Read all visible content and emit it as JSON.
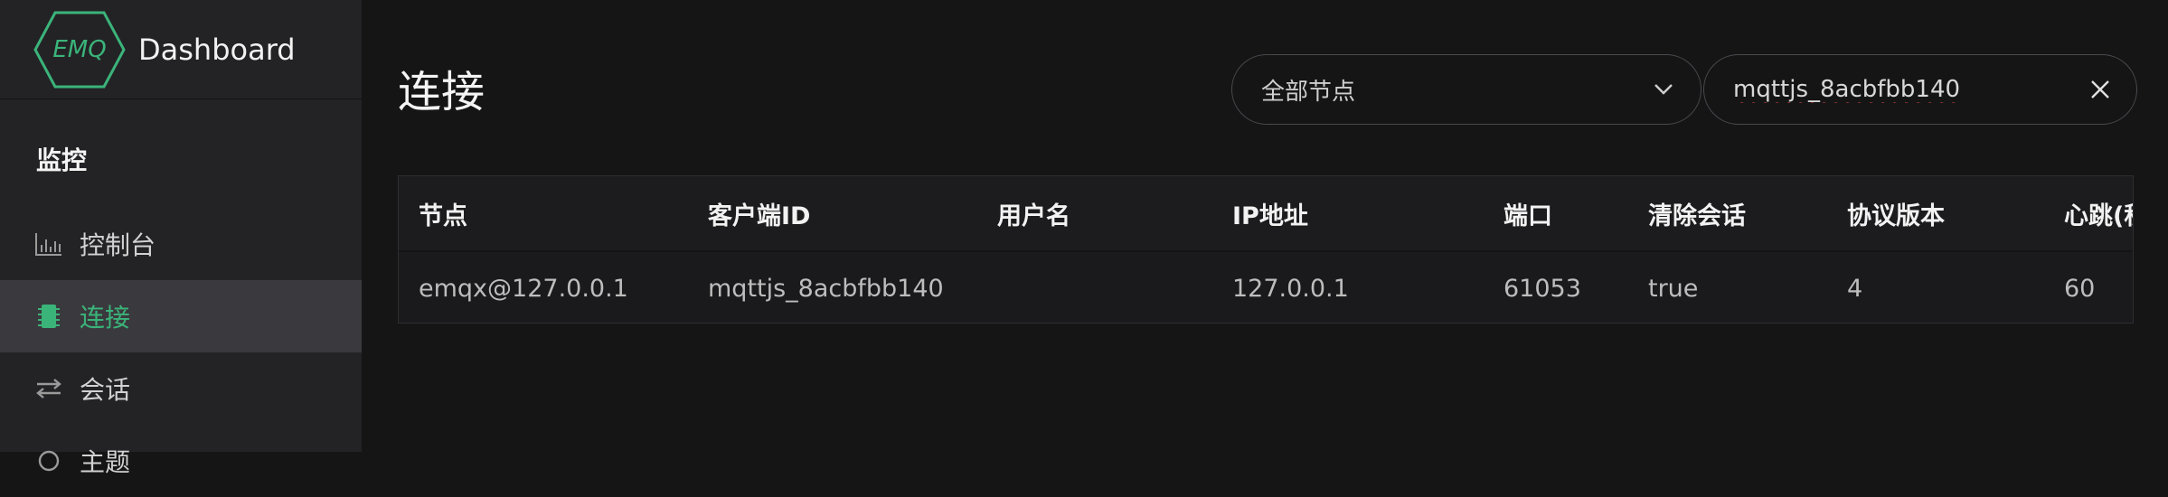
{
  "brand": {
    "logo_text": "EMQ",
    "title": "Dashboard"
  },
  "sidebar": {
    "section_title": "监控",
    "items": [
      {
        "label": "控制台",
        "icon": "bar-chart-icon",
        "active": false
      },
      {
        "label": "连接",
        "icon": "chip-icon",
        "active": true
      },
      {
        "label": "会话",
        "icon": "swap-arrows-icon",
        "active": false
      },
      {
        "label": "主题",
        "icon": "topic-icon",
        "active": false
      }
    ]
  },
  "main": {
    "title": "连接",
    "node_select": {
      "value": "全部节点"
    },
    "search": {
      "value": "mqttjs_8acbfbb140"
    }
  },
  "table": {
    "columns": [
      "节点",
      "客户端ID",
      "用户名",
      "IP地址",
      "端口",
      "清除会话",
      "协议版本",
      "心跳(秒)"
    ],
    "rows": [
      [
        "emqx@127.0.0.1",
        "mqttjs_8acbfbb140",
        "",
        "127.0.0.1",
        "61053",
        "true",
        "4",
        "60"
      ]
    ]
  },
  "colors": {
    "accent": "#3bb47a",
    "sidebar_bg": "#232326",
    "page_bg": "#151516"
  }
}
